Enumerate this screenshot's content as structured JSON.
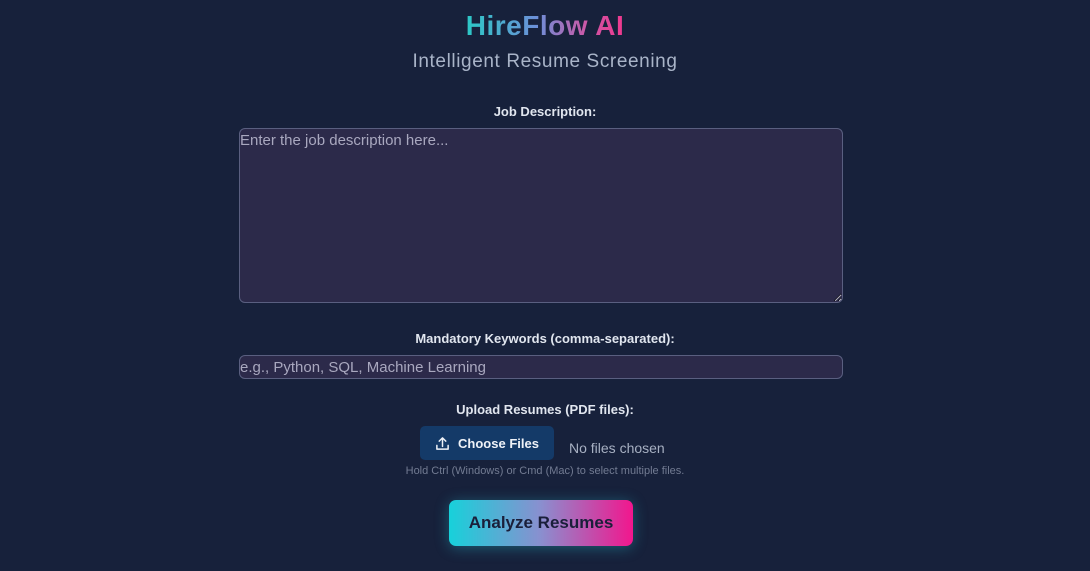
{
  "header": {
    "title": "HireFlow AI",
    "subtitle": "Intelligent Resume Screening"
  },
  "job_description": {
    "label": "Job Description:",
    "placeholder": "Enter the job description here...",
    "value": ""
  },
  "keywords": {
    "label": "Mandatory Keywords (comma-separated):",
    "placeholder": "e.g., Python, SQL, Machine Learning",
    "value": ""
  },
  "upload": {
    "label": "Upload Resumes (PDF files):",
    "button_label": "Choose Files",
    "button_icon": "upload-icon",
    "status": "No files chosen",
    "hint": "Hold Ctrl (Windows) or Cmd (Mac) to select multiple files."
  },
  "actions": {
    "analyze_label": "Analyze Resumes"
  },
  "colors": {
    "background": "#17213b",
    "field_background": "#2c2a4a",
    "choose_button": "#143a68",
    "gradient_start": "#17d1da",
    "gradient_end": "#f2168d"
  }
}
